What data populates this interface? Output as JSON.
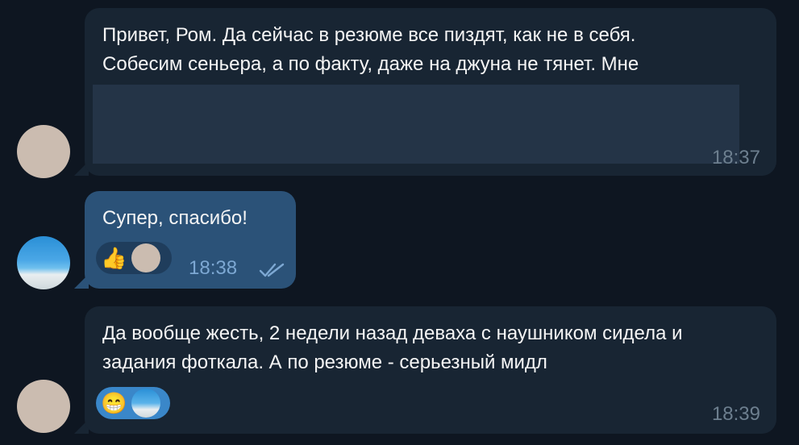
{
  "messages": [
    {
      "text": "Привет, Ром. Да сейчас в резюме все пиздят, как не в себя.\nСобесим сеньера, а по факту, даже на джуна не тянет. Мне",
      "time": "18:37"
    },
    {
      "text": "Супер, спасибо!",
      "time": "18:38",
      "reaction_emoji": "👍"
    },
    {
      "text": "Да вообще жесть, 2 недели назад деваха с наушником сидела и\nзадания фоткала. А по резюме - серьезный мидл",
      "time": "18:39",
      "reaction_emoji": "😁"
    }
  ],
  "icons": {
    "read_receipt": "double-check-icon"
  },
  "colors": {
    "background": "#0e1621",
    "incoming_bubble": "#182533",
    "outgoing_bubble": "#2b5278",
    "accent": "#3a87c9"
  }
}
